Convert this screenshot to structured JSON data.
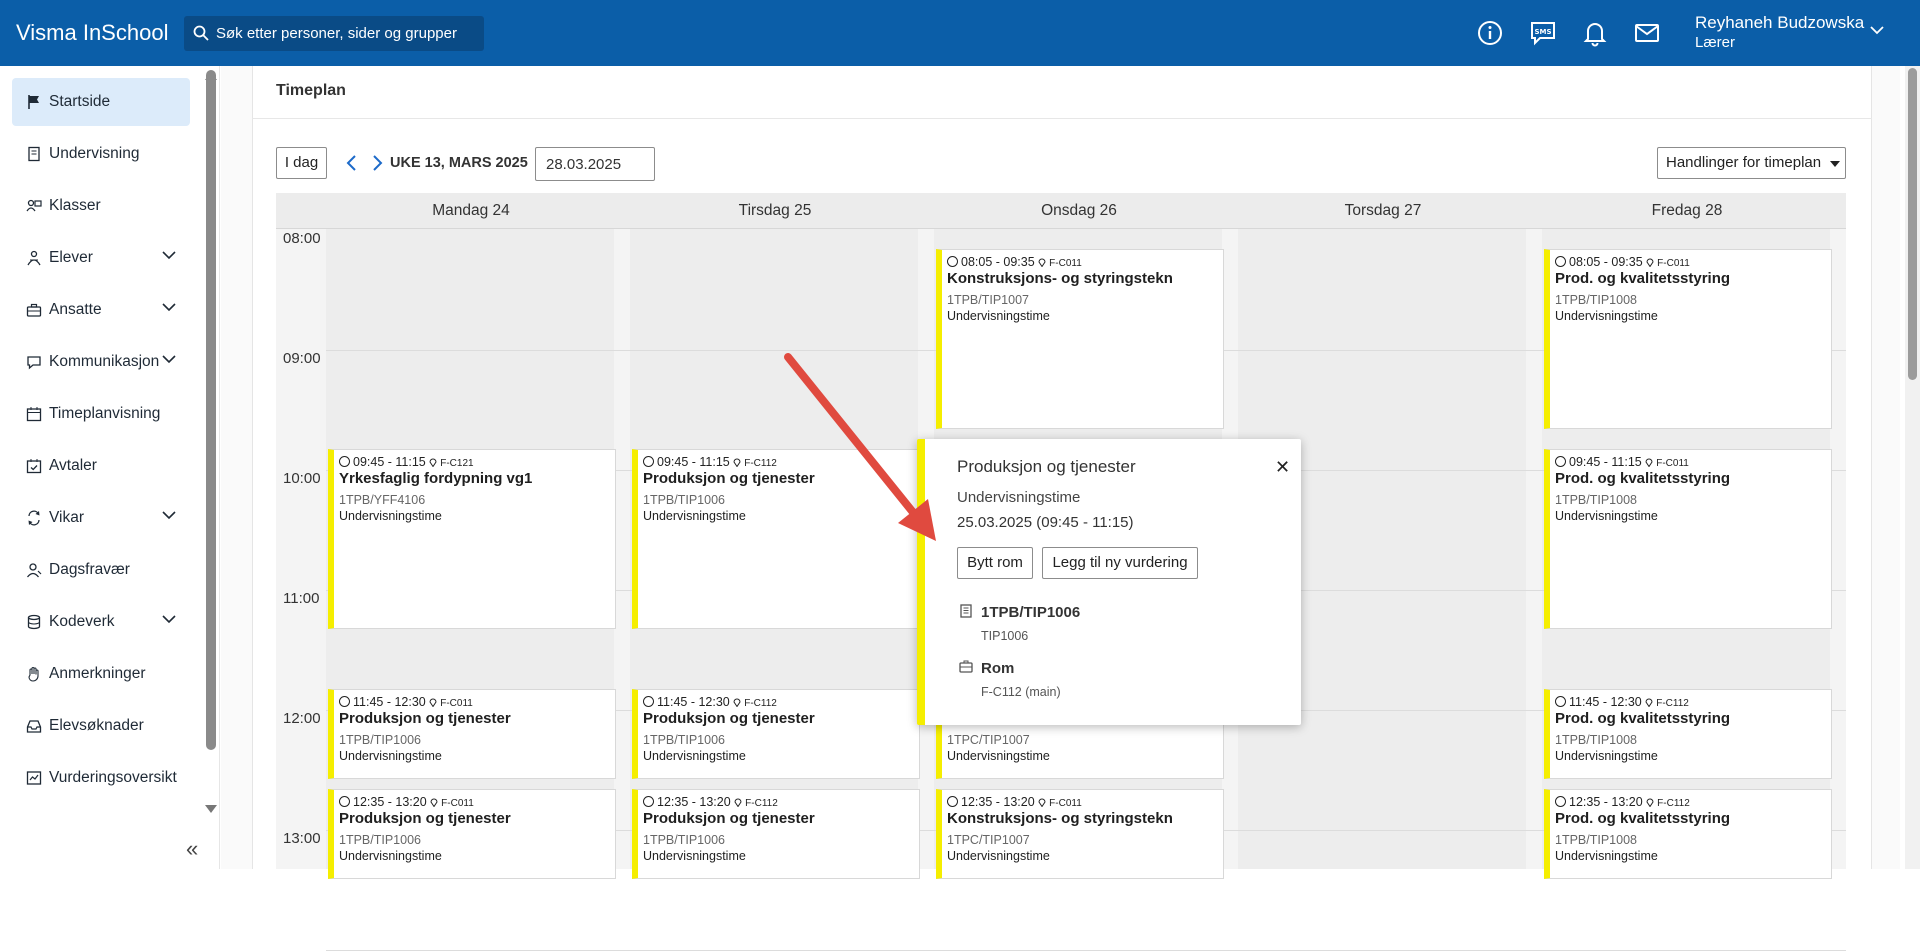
{
  "header": {
    "brand": "Visma InSchool",
    "search_placeholder": "Søk etter personer, sider og grupper",
    "icons": [
      "info-icon",
      "sms-icon",
      "bell-icon",
      "mail-icon"
    ],
    "user_name": "Reyhaneh Budzowska",
    "user_role": "Lærer"
  },
  "sidebar": {
    "items": [
      {
        "label": "Startside",
        "icon": "flag-icon",
        "active": true
      },
      {
        "label": "Undervisning",
        "icon": "book-icon"
      },
      {
        "label": "Klasser",
        "icon": "classes-icon"
      },
      {
        "label": "Elever",
        "icon": "students-icon",
        "expandable": true
      },
      {
        "label": "Ansatte",
        "icon": "briefcase-icon",
        "expandable": true
      },
      {
        "label": "Kommunikasjon",
        "icon": "chat-icon",
        "expandable": true
      },
      {
        "label": "Timeplanvisning",
        "icon": "calendar-icon"
      },
      {
        "label": "Avtaler",
        "icon": "calendar-check-icon"
      },
      {
        "label": "Vikar",
        "icon": "swap-icon",
        "expandable": true
      },
      {
        "label": "Dagsfravær",
        "icon": "person-icon"
      },
      {
        "label": "Kodeverk",
        "icon": "database-icon",
        "expandable": true
      },
      {
        "label": "Anmerkninger",
        "icon": "hand-icon"
      },
      {
        "label": "Elevsøknader",
        "icon": "inbox-icon"
      },
      {
        "label": "Vurderingsoversikt",
        "icon": "assessment-icon"
      }
    ],
    "collapse_glyph": "«"
  },
  "timetable": {
    "title": "Timeplan",
    "today_label": "I dag",
    "week_label": "UKE 13, MARS 2025",
    "date_value": "28.03.2025",
    "actions_label": "Handlinger for timeplan",
    "days": [
      "Mandag 24",
      "Tirsdag 25",
      "Onsdag 26",
      "Torsdag 27",
      "Fredag 28"
    ],
    "hours": [
      "08:00",
      "09:00",
      "10:00",
      "11:00",
      "12:00",
      "13:00"
    ],
    "events": [
      {
        "day": 2,
        "time": "08:05 - 09:35",
        "room": "F-C011",
        "title": "Konstruksjons- og styringstekn",
        "code": "1TPB/TIP1007",
        "type": "Undervisningstime"
      },
      {
        "day": 4,
        "time": "08:05 - 09:35",
        "room": "F-C011",
        "title": "Prod. og kvalitetsstyring",
        "code": "1TPB/TIP1008",
        "type": "Undervisningstime"
      },
      {
        "day": 0,
        "time": "09:45 - 11:15",
        "room": "F-C121",
        "title": "Yrkesfaglig fordypning vg1",
        "code": "1TPB/YFF4106",
        "type": "Undervisningstime"
      },
      {
        "day": 1,
        "time": "09:45 - 11:15",
        "room": "F-C112",
        "title": "Produksjon og tjenester",
        "code": "1TPB/TIP1006",
        "type": "Undervisningstime"
      },
      {
        "day": 4,
        "time": "09:45 - 11:15",
        "room": "F-C011",
        "title": "Prod. og kvalitetsstyring",
        "code": "1TPB/TIP1008",
        "type": "Undervisningstime"
      },
      {
        "day": 0,
        "time": "11:45 - 12:30",
        "room": "F-C011",
        "title": "Produksjon og tjenester",
        "code": "1TPB/TIP1006",
        "type": "Undervisningstime"
      },
      {
        "day": 1,
        "time": "11:45 - 12:30",
        "room": "F-C112",
        "title": "Produksjon og tjenester",
        "code": "1TPB/TIP1006",
        "type": "Undervisningstime"
      },
      {
        "day": 2,
        "time": "",
        "room": "",
        "title": "",
        "code": "1TPC/TIP1007",
        "type": "Undervisningstime"
      },
      {
        "day": 4,
        "time": "11:45 - 12:30",
        "room": "F-C112",
        "title": "Prod. og kvalitetsstyring",
        "code": "1TPB/TIP1008",
        "type": "Undervisningstime"
      },
      {
        "day": 0,
        "time": "12:35 - 13:20",
        "room": "F-C011",
        "title": "Produksjon og tjenester",
        "code": "1TPB/TIP1006",
        "type": "Undervisningstime"
      },
      {
        "day": 1,
        "time": "12:35 - 13:20",
        "room": "F-C112",
        "title": "Produksjon og tjenester",
        "code": "1TPB/TIP1006",
        "type": "Undervisningstime"
      },
      {
        "day": 2,
        "time": "12:35 - 13:20",
        "room": "F-C011",
        "title": "Konstruksjons- og styringstekn",
        "code": "1TPC/TIP1007",
        "type": "Undervisningstime"
      },
      {
        "day": 4,
        "time": "12:35 - 13:20",
        "room": "F-C112",
        "title": "Prod. og kvalitetsstyring",
        "code": "1TPB/TIP1008",
        "type": "Undervisningstime"
      }
    ]
  },
  "popover": {
    "title": "Produksjon og tjenester",
    "type": "Undervisningstime",
    "datetime": "25.03.2025 (09:45 - 11:15)",
    "btn_change_room": "Bytt rom",
    "btn_add_assessment": "Legg til ny vurdering",
    "group": "1TPB/TIP1006",
    "group_sub": "TIP1006",
    "room_label": "Rom",
    "room_value": "F-C112 (main)",
    "close_glyph": "✕"
  },
  "colors": {
    "topbar": "#0b5ea8",
    "active_nav": "#dcebfa",
    "event_accent": "#f5ee00",
    "annotation_arrow": "#e04a3f"
  }
}
